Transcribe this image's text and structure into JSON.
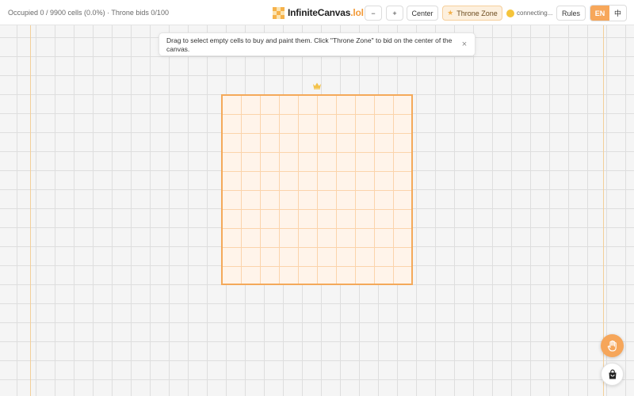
{
  "stats": {
    "text": "Occupied 0 / 9900 cells (0.0%) · Throne bids 0/100"
  },
  "brand": {
    "name": "InfiniteCanvas",
    "tld": ".lol"
  },
  "toolbar": {
    "zoom_out_label": "−",
    "zoom_in_label": "+",
    "center_label": "Center",
    "throne_icon": "star-icon",
    "throne_label": "Throne Zone",
    "status_text": "connecting...",
    "rules_label": "Rules"
  },
  "language": {
    "en_label": "EN",
    "zh_label": "中",
    "selected": "EN"
  },
  "tooltip": {
    "text": "Drag to select empty cells to buy and paint them. Click \"Throne Zone\" to bid on the center of the canvas.",
    "close_label": "×"
  },
  "icons": {
    "crown": "crown-icon",
    "hand": "hand-icon",
    "bag": "shopping-bag-icon"
  },
  "colors": {
    "accent": "#f4a95a",
    "throne_fill": "#fff4ea",
    "status_dot": "#f5c43a",
    "brand_tld": "#f29a38"
  }
}
